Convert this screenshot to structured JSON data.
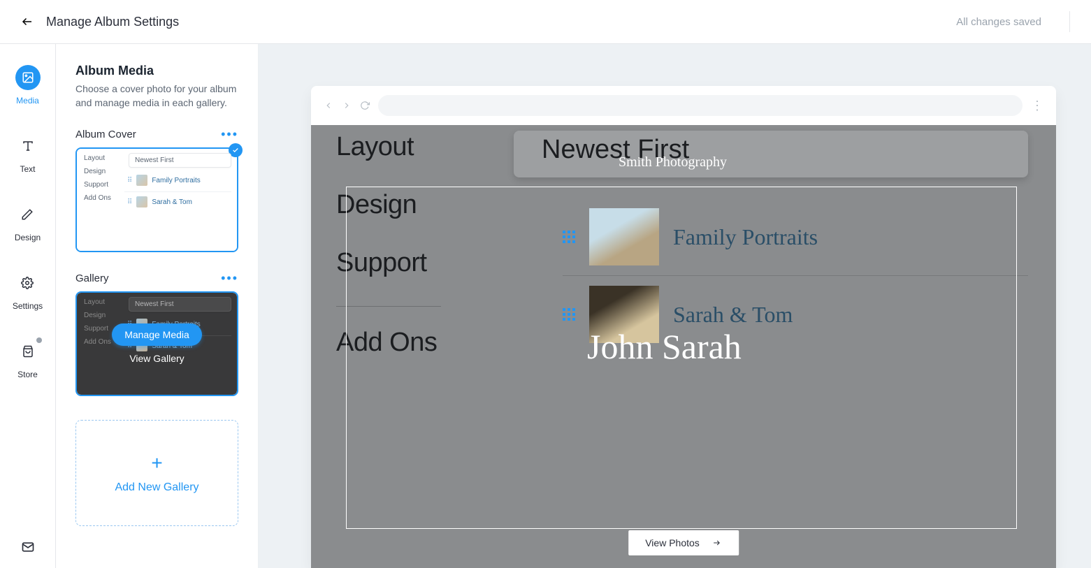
{
  "topbar": {
    "title": "Manage Album Settings",
    "status": "All changes saved"
  },
  "nav": {
    "media": "Media",
    "text": "Text",
    "design": "Design",
    "settings": "Settings",
    "store": "Store"
  },
  "panel": {
    "heading": "Album Media",
    "desc": "Choose a cover photo for your album and manage media in each gallery.",
    "album_cover_label": "Album Cover",
    "gallery_label": "Gallery",
    "manage_media": "Manage Media",
    "view_gallery": "View Gallery",
    "add_new_gallery": "Add New Gallery"
  },
  "mini": {
    "left": [
      "Layout",
      "Design",
      "Support",
      "Add Ons"
    ],
    "sort": "Newest First",
    "rows": [
      "Family Portraits",
      "Sarah & Tom"
    ]
  },
  "preview": {
    "brand": "Smith Photography",
    "album_title": "John Sarah",
    "left_nav": [
      "Layout",
      "Design",
      "Support",
      "Add Ons"
    ],
    "sort_pill": "Newest First",
    "entries": [
      "Family Portraits",
      "Sarah & Tom"
    ],
    "view_photos": "View Photos"
  }
}
